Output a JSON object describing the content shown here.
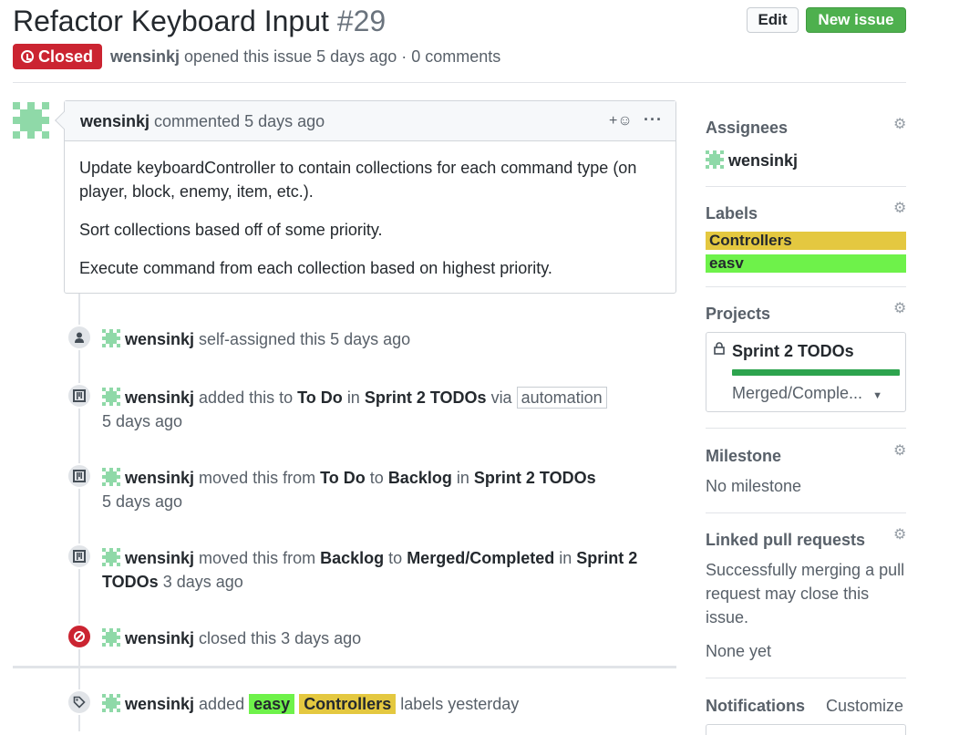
{
  "issue": {
    "title": "Refactor Keyboard Input",
    "number": "#29",
    "state": "Closed",
    "author": "wensinkj",
    "opened_text": "opened this issue 5 days ago · 0 comments"
  },
  "header_buttons": {
    "edit": "Edit",
    "new_issue": "New issue"
  },
  "comment": {
    "author": "wensinkj",
    "meta": "commented 5 days ago",
    "reaction": "+☺",
    "more": "···",
    "paragraphs": [
      "Update keyboardController to contain collections for each command type (on player, block, enemy, item, etc.).",
      "Sort collections based off of some priority.",
      "Execute command from each collection based on highest priority."
    ]
  },
  "events": [
    {
      "icon": "person-icon",
      "user": "wensinkj",
      "text": "self-assigned this 5 days ago"
    },
    {
      "icon": "project-icon",
      "user": "wensinkj",
      "t1": "added this to",
      "col": "To Do",
      "t2": "in",
      "proj": "Sprint 2 TODOs",
      "t3": "via",
      "chip": "automation",
      "time": "5 days ago"
    },
    {
      "icon": "project-icon",
      "user": "wensinkj",
      "t1": "moved this from",
      "from": "To Do",
      "t2": "to",
      "to": "Backlog",
      "t3": "in",
      "proj": "Sprint 2 TODOs",
      "time": "5 days ago"
    },
    {
      "icon": "project-icon",
      "user": "wensinkj",
      "t1": "moved this from",
      "from": "Backlog",
      "t2": "to",
      "to": "Merged/Completed",
      "t3": "in",
      "proj": "Sprint 2 TODOs",
      "time": "3 days ago"
    },
    {
      "icon": "circle-slash-icon",
      "user": "wensinkj",
      "text": "closed this 3 days ago"
    },
    {
      "icon": "tag-icon",
      "user": "wensinkj",
      "t1": "added",
      "label1": "easy",
      "label2": "Controllers",
      "t2": "labels yesterday"
    }
  ],
  "sidebar": {
    "assignees": {
      "heading": "Assignees",
      "user": "wensinkj"
    },
    "labels": {
      "heading": "Labels",
      "items": [
        {
          "name": "Controllers",
          "color": "#e4c840"
        },
        {
          "name": "easv",
          "color": "#6ef24a"
        }
      ]
    },
    "projects": {
      "heading": "Projects",
      "name": "Sprint 2 TODOs",
      "column": "Merged/Comple..."
    },
    "milestone": {
      "heading": "Milestone",
      "value": "No milestone"
    },
    "linked_prs": {
      "heading": "Linked pull requests",
      "desc": "Successfully merging a pull request may close this issue.",
      "value": "None yet"
    },
    "notifications": {
      "heading": "Notifications",
      "action": "Customize"
    }
  },
  "colors": {
    "closed": "#cb2431",
    "new_issue": "#4eb04e",
    "identicon": "#8fd9a8",
    "label_easy": "#6ef24a",
    "label_controllers": "#e4c840"
  }
}
